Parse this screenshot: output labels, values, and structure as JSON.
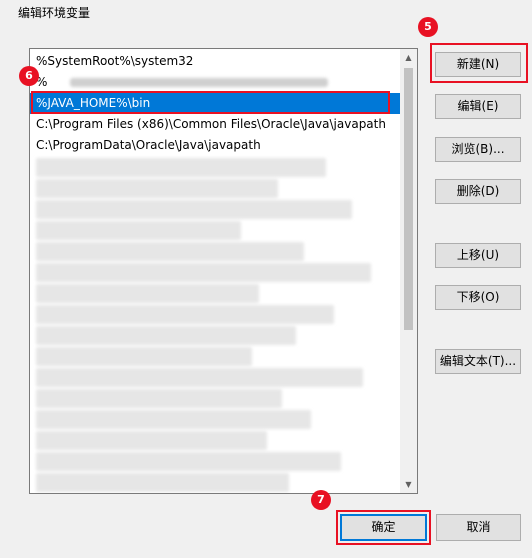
{
  "window": {
    "title": "编辑环境变量"
  },
  "list": {
    "items": [
      {
        "text": "%SystemRoot%\\system32",
        "state": "normal"
      },
      {
        "text": "%",
        "state": "edit-obscured"
      },
      {
        "text": "%JAVA_HOME%\\bin",
        "state": "selected"
      },
      {
        "text": "C:\\Program Files (x86)\\Common Files\\Oracle\\Java\\javapath",
        "state": "normal"
      },
      {
        "text": "C:\\ProgramData\\Oracle\\Java\\javapath",
        "state": "normal"
      }
    ],
    "obscured_rows": 16
  },
  "buttons": {
    "new": "新建(N)",
    "edit": "编辑(E)",
    "browse": "浏览(B)...",
    "delete": "删除(D)",
    "move_up": "上移(U)",
    "move_down": "下移(O)",
    "edit_text": "编辑文本(T)...",
    "ok": "确定",
    "cancel": "取消"
  },
  "annotations": {
    "step_new": "5",
    "step_entry": "6",
    "step_ok": "7"
  },
  "colors": {
    "selection": "#0078d7",
    "annotation": "#e81123"
  }
}
